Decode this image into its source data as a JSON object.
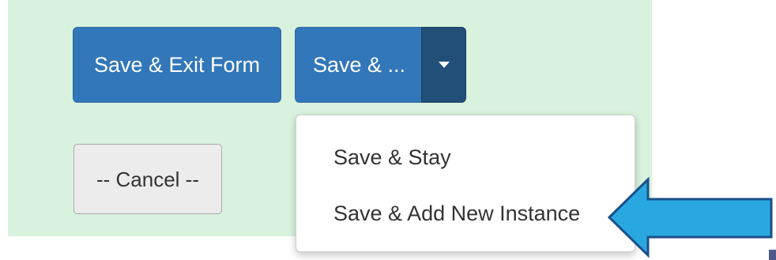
{
  "form_actions": {
    "save_exit_label": "Save & Exit Form",
    "save_as_label": "Save & ...",
    "cancel_label": "-- Cancel --"
  },
  "dropdown": {
    "items": [
      {
        "label": "Save & Stay"
      },
      {
        "label": "Save & Add New Instance"
      }
    ]
  },
  "colors": {
    "panel_bg": "#d9f2dd",
    "primary": "#3277b9",
    "primary_dark": "#214f78",
    "cancel_bg": "#ececec",
    "arrow_fill": "#29a8e0",
    "arrow_stroke": "#1b4f8a"
  },
  "icons": {
    "caret": "chevron-down-icon",
    "callout": "arrow-left-icon"
  }
}
